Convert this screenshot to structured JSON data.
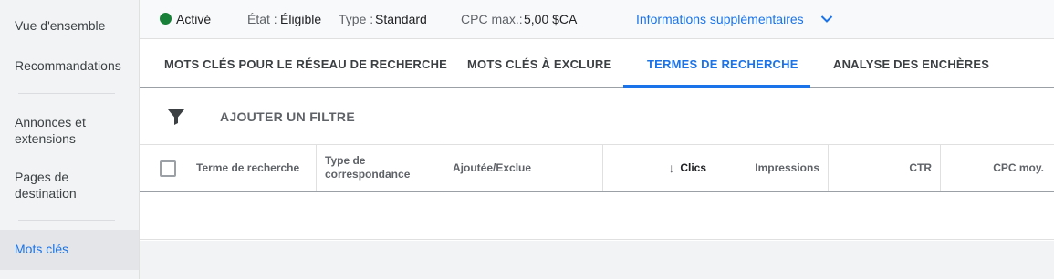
{
  "sidebar": {
    "items": [
      {
        "label": "Vue d'ensemble"
      },
      {
        "label": "Recommandations"
      },
      {
        "label": "Annonces et extensions"
      },
      {
        "label": "Pages de destination"
      },
      {
        "label": "Mots clés"
      }
    ],
    "active_item": "Mots clés"
  },
  "topbar": {
    "status": "Activé",
    "status_color": "#188038",
    "state_label": "État :",
    "state_value": "Éligible",
    "type_label": "Type :",
    "type_value": "Standard",
    "cpc_label": "CPC max.:",
    "cpc_value": "5,00 $CA",
    "more_info": "Informations supplémentaires"
  },
  "tabs": [
    {
      "label": "MOTS CLÉS POUR LE RÉSEAU DE RECHERCHE",
      "active": false
    },
    {
      "label": "MOTS CLÉS À EXCLURE",
      "active": false
    },
    {
      "label": "TERMES DE RECHERCHE",
      "active": true
    },
    {
      "label": "ANALYSE DES ENCHÈRES",
      "active": false
    }
  ],
  "filter": {
    "label": "AJOUTER UN FILTRE",
    "icon": "filter-icon"
  },
  "table": {
    "columns": [
      {
        "label": "Terme de recherche"
      },
      {
        "label": "Type de correspondance"
      },
      {
        "label": "Ajoutée/Exclue"
      },
      {
        "label": "Clics",
        "sorted": "desc"
      },
      {
        "label": "Impressions"
      },
      {
        "label": "CTR"
      },
      {
        "label": "CPC moy."
      }
    ],
    "rows": []
  },
  "colors": {
    "accent": "#1a73e8",
    "sidebar_bg": "#f1f3f4"
  }
}
